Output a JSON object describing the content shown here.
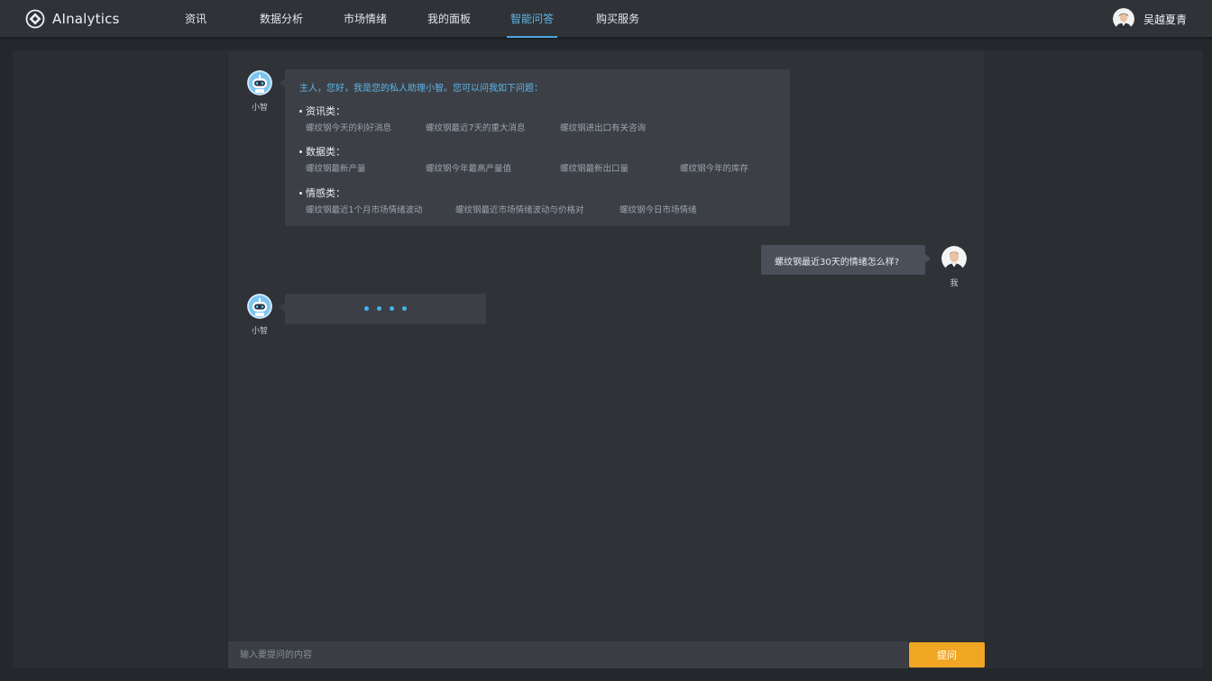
{
  "app": {
    "name": "AInalytics"
  },
  "nav": {
    "items": [
      {
        "label": "资讯",
        "active": false
      },
      {
        "label": "数据分析",
        "active": false
      },
      {
        "label": "市场情绪",
        "active": false
      },
      {
        "label": "我的面板",
        "active": false
      },
      {
        "label": "智能问答",
        "active": true
      },
      {
        "label": "购买服务",
        "active": false
      }
    ]
  },
  "user": {
    "name": "吴越夏青"
  },
  "chat": {
    "bot_name": "小智",
    "me_label": "我",
    "greeting": "主人，您好，我是您的私人助理小智。您可以问我如下问题：",
    "categories": [
      {
        "title": "资讯类：",
        "questions": [
          "螺纹钢今天的利好消息",
          "螺纹钢最近7天的重大消息",
          "螺纹钢进出口有关咨询"
        ]
      },
      {
        "title": "数据类：",
        "questions": [
          "螺纹钢最新产量",
          "螺纹钢今年最高产量值",
          "螺纹钢最新出口量",
          "螺纹钢今年的库存"
        ]
      },
      {
        "title": "情感类：",
        "questions": [
          "螺纹钢最近1个月市场情绪波动",
          "螺纹钢最近市场情绪波动与价格对",
          "螺纹钢今日市场情绪"
        ]
      }
    ],
    "user_message": "螺纹钢最近30天的情绪怎么样?"
  },
  "input": {
    "placeholder": "输入要提问的内容",
    "value": ""
  },
  "ask_button": {
    "label": "提问"
  },
  "colors": {
    "accent": "#4aa6e0",
    "button": "#f0a623",
    "typing_dot": "#43b3ea"
  }
}
